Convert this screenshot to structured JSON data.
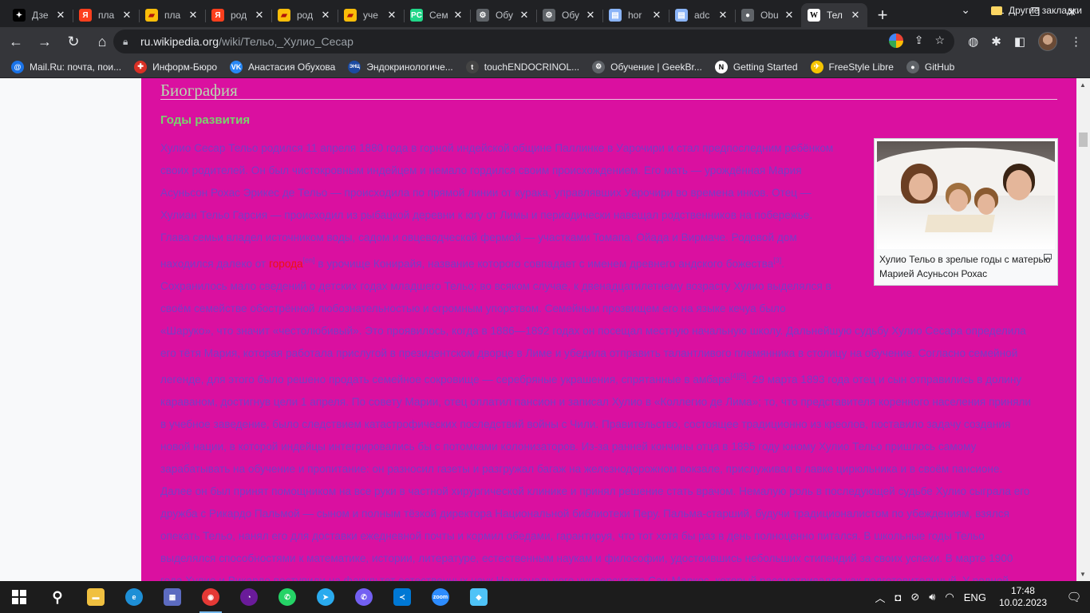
{
  "browser": {
    "tabs": [
      {
        "title": "Дзе",
        "favicon": "zen-icon",
        "color": "#000000",
        "glyph": "✦"
      },
      {
        "title": "пла",
        "favicon": "yandex-icon",
        "color": "#fc3f1d",
        "glyph": "Я"
      },
      {
        "title": "пла",
        "favicon": "yandex-bookmark-icon",
        "color": "#fbbd09",
        "glyph": "▰"
      },
      {
        "title": "род",
        "favicon": "yandex-icon",
        "color": "#fc3f1d",
        "glyph": "Я"
      },
      {
        "title": "род",
        "favicon": "yandex-bookmark-icon",
        "color": "#fbbd09",
        "glyph": "▰"
      },
      {
        "title": "уче",
        "favicon": "yandex-bookmark-icon",
        "color": "#fbbd09",
        "glyph": "▰"
      },
      {
        "title": "Сем",
        "favicon": "pycharm-icon",
        "color": "#21d789",
        "glyph": "PC"
      },
      {
        "title": "Обу",
        "favicon": "geekbrains-icon",
        "color": "#5f6368",
        "glyph": "⚙"
      },
      {
        "title": "Обу",
        "favicon": "geekbrains-icon",
        "color": "#5f6368",
        "glyph": "⚙"
      },
      {
        "title": "hor",
        "favicon": "doc-icon",
        "color": "#8ab4f8",
        "glyph": "▤"
      },
      {
        "title": "adc",
        "favicon": "doc-icon",
        "color": "#8ab4f8",
        "glyph": "▤"
      },
      {
        "title": "Obu",
        "favicon": "github-icon",
        "color": "#5f6368",
        "glyph": "●"
      },
      {
        "title": "Тел",
        "favicon": "wikipedia-icon",
        "color": "#ffffff",
        "glyph": "W",
        "active": true
      }
    ],
    "close_glyph": "✕",
    "new_tab_glyph": "+",
    "url_host": "ru.wikipedia.org",
    "url_path": "/wiki/Тельо,_Хулио_Сесар",
    "bookmarks": [
      {
        "label": "Mail.Ru: почта, пои...",
        "icon": "mailru-icon",
        "color": "#1a73e8",
        "glyph": "@"
      },
      {
        "label": "Информ-Бюро",
        "icon": "cross-icon",
        "color": "#d93025",
        "glyph": "✚"
      },
      {
        "label": "Анастасия Обухова",
        "icon": "vk-icon",
        "color": "#2787f5",
        "glyph": "VK"
      },
      {
        "label": "Эндокринологиче...",
        "icon": "enc-icon",
        "color": "#1b4aa1",
        "glyph": "ЭНЦ"
      },
      {
        "label": "touchENDOCRINOL...",
        "icon": "touch-icon",
        "color": "#444444",
        "glyph": "t"
      },
      {
        "label": "Обучение | GeekBr...",
        "icon": "geekbrains-icon",
        "color": "#5f6368",
        "glyph": "⚙"
      },
      {
        "label": "Getting Started",
        "icon": "notion-icon",
        "color": "#ffffff",
        "glyph": "N"
      },
      {
        "label": "FreeStyle Libre",
        "icon": "freestyle-icon",
        "color": "#f5c400",
        "glyph": "✈"
      },
      {
        "label": "GitHub",
        "icon": "github-icon",
        "color": "#5f6368",
        "glyph": "●"
      }
    ],
    "other_bookmarks": "Другие закладки"
  },
  "article": {
    "section_heading": "Биография",
    "subsection_heading": "Годы развития",
    "figure_caption": "Хулио Тельо в зрелые годы с матерью Марией Асуньсон Рохас",
    "lines": [
      "Хулио Сесар Тельо родился 11 апреля 1880 года в горной индейской общине Паллинке в Уарочири и стал предпоследним ребёнком",
      "своих родителей. Он был чистокровным индейцем и немало гордился своим происхождением. Его мать — урождённая Мария",
      "Асуньсон Рохас Эрикес де Тельо — происходила по прямой линии от курака, управлявших Уарочири во времена инков. Отец —",
      "Хулиан Тельо Гарсия — происходил из рыбацкой деревни к югу от Лимы и периодически навещал родственников на побережье.",
      "Глава семьи владел источником воды, садом и овцеводческой фермой — участками Томапа, Ойада и Вирмаче. Родовой дом",
      "",
      "Сохранилось мало сведений о детских годах младшего Тельо; во всяком случае, к двенадцатилетнему возрасту Хулио выделялся в",
      "своём семействе обострённой любознательностью и огромным упорством. Семейным прозвищем его на языке кечуа было",
      "«Шаруко», что значит «честолюбивый». Это проявилось, когда в 1886—1892 годах он посещал местную начальную школу. Дальнейшую судьбу Хулио Сесара определила",
      "его тётя Мария, которая работала прислугой в президентском дворце в Лиме и убедила отправить талантливого племянника в столицу на обучение. Согласно семейной",
      "",
      "караваном, достигнув цели 1 апреля. По совету Марии, отец оплатил пансион и записал Хулио в «Коллегио де Лима»; то, что представителя коренного населения приняли",
      "в учебное заведение, было следствием катастрофических последствий войны с Чили. Правительство, состоящее традиционно из креолов, поставило задачу создания",
      "новой нации, в которой индейцы интегрировались бы с потомками колонизаторов. Из-за ранней кончины отца в 1895 году юному Хулио Тельо пришлось самому",
      "зарабатывать на обучение и пропитание: он разносил газеты и разгружал багаж на железнодорожном вокзале, прислуживал в лавке цирюльника и в своём пансионе.",
      "Далее он был принят помощником на все руки в частной хирургической клинике и принял решение стать врачом. Немалую роль в последующей судьбе Хулио сыграла его",
      "дружба с Рикардо Пальмой — сыном и полным тёзкой директора Национальной библиотеки Перу. Пальма-старший, будучи традиционалистом по убеждениям, взялся",
      "опекать Тельо, нанял его для доставки ежедневной почты и кормил обедами, гарантируя, что тот хотя бы раз в день полноценно питался. В школьные годы Тельо",
      "выделялся способностями к математике, истории, литературе, естественным наукам и философии, удостоившись небольших стипендий за своих успехи. В марте 1900",
      "года Хулио и Рикардо поступили на факультет естественных наук Национального университета Сан-Маркос, который рассматривался как подготовительный. У родной"
    ],
    "line6_a": "находился далеко от ",
    "line6_red": "города",
    "line6_sup1": "[en]",
    "line6_b": " в урочище Конирайя, название которого совпадает с именем древнего андского божества",
    "line6_sup2": "[3]",
    "line6_c": ".",
    "line11_a": "легенде, для этого было решено продать семейное сокровище — серебряные украшения, спрятанные в амбаре",
    "line11_sup": "[4][5]",
    "line11_b": ". 29 марта 1893 года отец и сын отправились в долину"
  },
  "taskbar": {
    "apps": [
      {
        "name": "search-icon",
        "glyph": "⚲",
        "color": "transparent"
      },
      {
        "name": "file-explorer-icon",
        "glyph": "▬",
        "color": "#f0c040"
      },
      {
        "name": "edge-icon",
        "glyph": "e",
        "color": "#1e8fd6"
      },
      {
        "name": "calculator-icon",
        "glyph": "▦",
        "color": "#5c6bc0"
      },
      {
        "name": "chrome-icon",
        "glyph": "◉",
        "color": "#e53935",
        "active": true
      },
      {
        "name": "app-purple-icon",
        "glyph": "◔",
        "color": "#6a1b9a"
      },
      {
        "name": "whatsapp-icon",
        "glyph": "✆",
        "color": "#25d366"
      },
      {
        "name": "telegram-icon",
        "glyph": "➤",
        "color": "#2aabee"
      },
      {
        "name": "viber-icon",
        "glyph": "✆",
        "color": "#7360f2"
      },
      {
        "name": "vscode-icon",
        "glyph": "≺",
        "color": "#0078d4"
      },
      {
        "name": "zoom-icon",
        "glyph": "zoom",
        "color": "#2d8cff"
      },
      {
        "name": "paint-icon",
        "glyph": "◆",
        "color": "#4fc3f7"
      }
    ],
    "language": "ENG",
    "time": "17:48",
    "date": "10.02.2023"
  }
}
